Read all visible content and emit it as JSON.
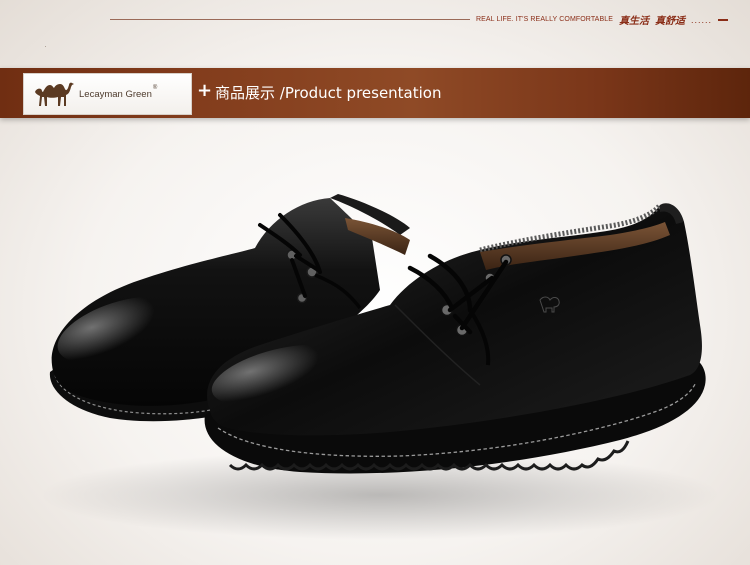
{
  "tagline": {
    "english": "REAL LIFE. IT'S REALLY COMFORTABLE",
    "chinese_1": "真生活",
    "chinese_2": "真舒适",
    "ellipsis": "......"
  },
  "banner": {
    "brand_name": "Lecayman Green",
    "brand_mark": "®",
    "plus_symbol": "+",
    "section_title": "商品展示 /Product presentation",
    "logo_icon": "camel-icon",
    "colors": {
      "banner_brown": "#823c1c",
      "accent_red": "#8a2d17"
    }
  },
  "product": {
    "image_subject": "black leather lace-up shoes",
    "icon": "shoe-icon"
  }
}
